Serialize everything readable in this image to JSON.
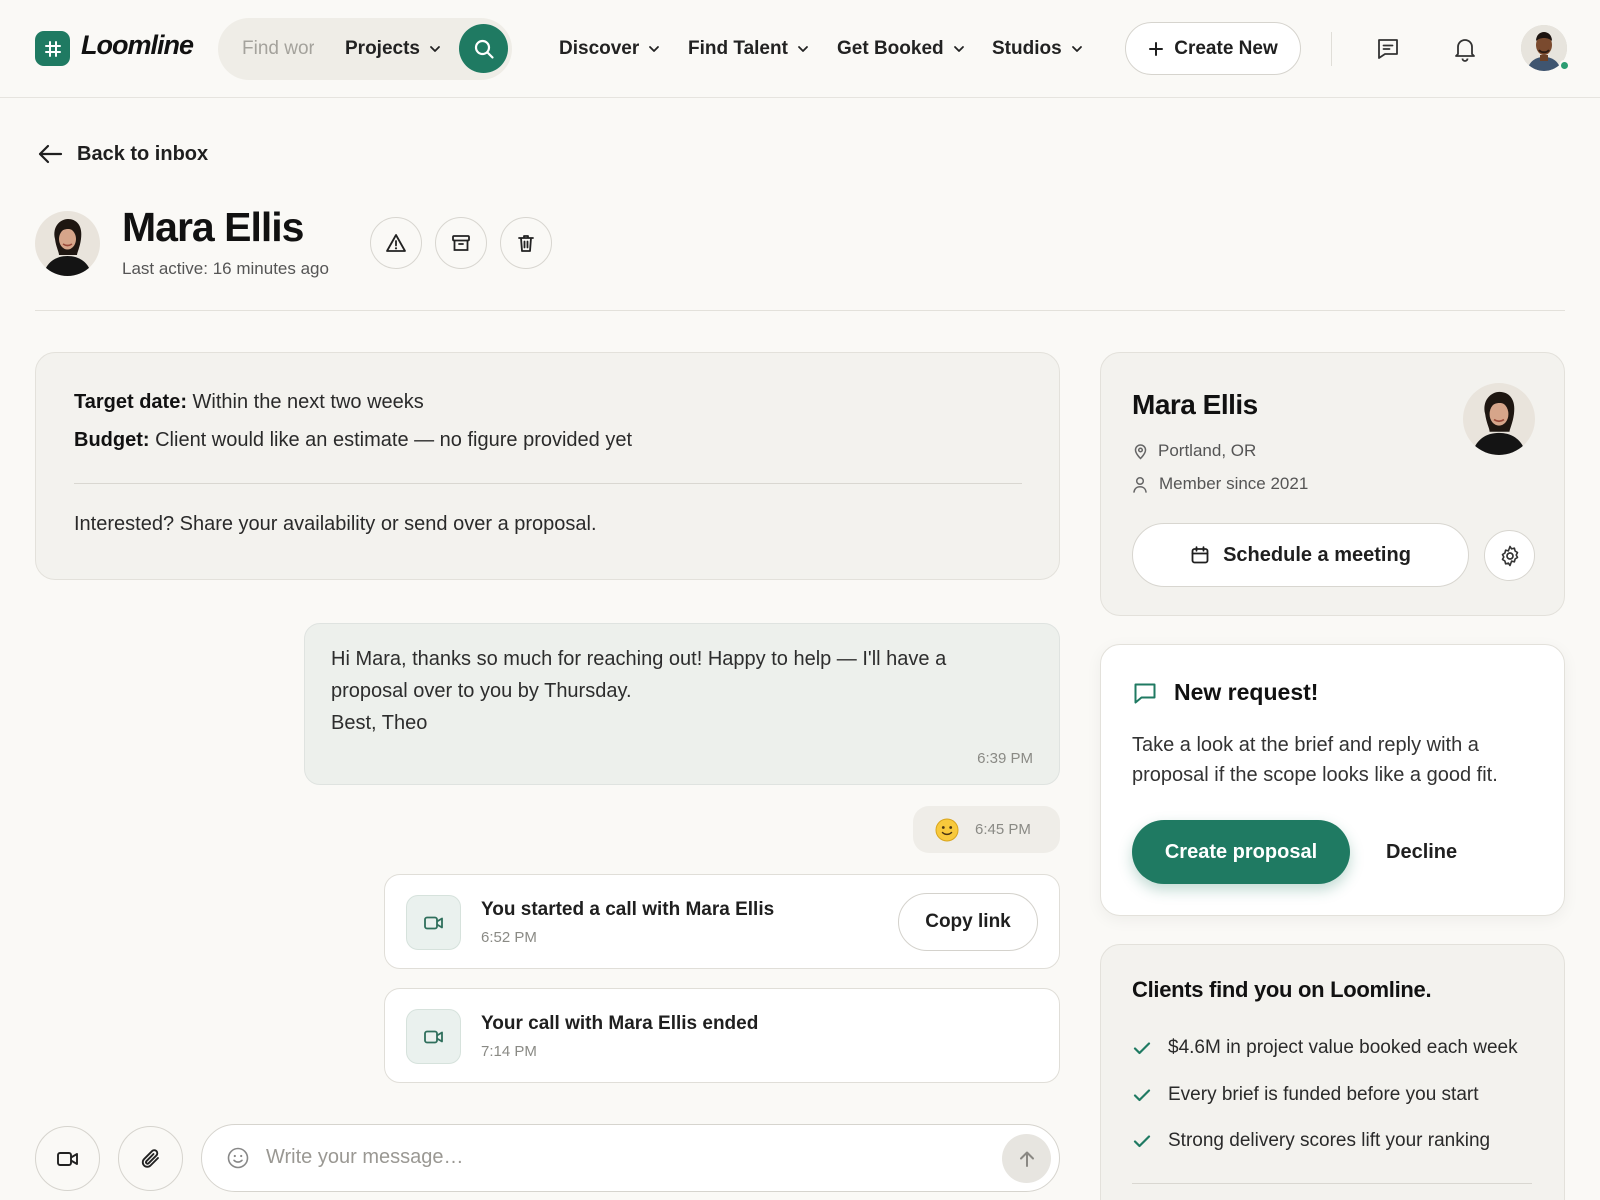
{
  "nav": {
    "brand": "Loomline",
    "search_placeholder": "Find work",
    "search_scope": "Projects",
    "links": [
      "Discover",
      "Find Talent",
      "Get Booked",
      "Studios"
    ],
    "create_new": "Create New"
  },
  "header": {
    "back_label": "Back to inbox",
    "name": "Mara Ellis",
    "last_active": "Last active: 16 minutes ago"
  },
  "brief": {
    "target_label": "Target date:",
    "target_value": "Within the next two weeks",
    "budget_label": "Budget:",
    "budget_value": "Client would like an estimate — no figure provided yet",
    "cta": "Interested? Share your availability or send over a proposal."
  },
  "thread": {
    "message": {
      "text": "Hi Mara, thanks so much for reaching out! Happy to help — I'll have a\nproposal over to you by Thursday.\nBest, Theo",
      "time": "6:39 PM"
    },
    "reaction": {
      "emoji": "🙂",
      "time": "6:45 PM"
    },
    "calls": [
      {
        "title": "You started a call with Mara Ellis",
        "time": "6:52 PM",
        "action": "Copy link"
      },
      {
        "title": "Your call with Mara Ellis ended",
        "time": "7:14 PM"
      }
    ]
  },
  "composer": {
    "placeholder": "Write your message…"
  },
  "profile": {
    "name": "Mara Ellis",
    "location": "Portland, OR",
    "member_since": "Member since 2021",
    "schedule_label": "Schedule a meeting"
  },
  "request": {
    "title": "New request!",
    "body": "Take a look at the brief and reply with a proposal if the scope looks like a good fit.",
    "primary": "Create proposal",
    "secondary": "Decline"
  },
  "promo": {
    "title": "Clients find you on Loomline.",
    "items": [
      "$4.6M in project value booked each week",
      "Every brief is funded before you start",
      "Strong delivery scores lift your ranking"
    ]
  },
  "colors": {
    "accent": "#1f7a62",
    "background": "#faf9f6",
    "card": "#f3f2ee",
    "online": "#2b9d72"
  }
}
